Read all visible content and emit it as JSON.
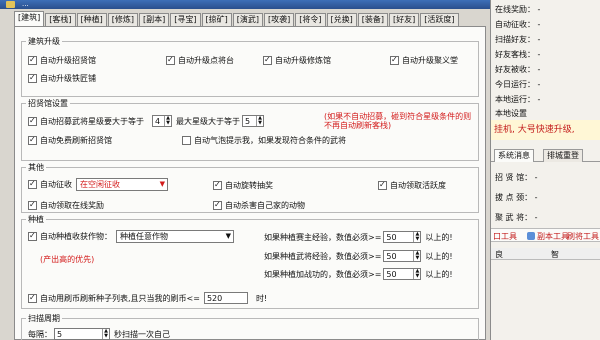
{
  "window": {
    "title": "..."
  },
  "tabs": [
    "[建筑]",
    "[客栈]",
    "[种植]",
    "[修炼]",
    "[副本]",
    "[寻宝]",
    "[掠矿]",
    "[演武]",
    "[攻袭]",
    "[将令]",
    "[兑换]",
    "[装备]",
    "[好友]",
    "[活跃度]"
  ],
  "jianzhu": {
    "title": "建筑升级",
    "items": [
      "自动升级招贤馆",
      "自动升级点将台",
      "自动升级修炼馆",
      "自动升级聚义堂",
      "自动升级铁匠铺"
    ]
  },
  "zhaoxian": {
    "title": "招贤馆设置",
    "star_label": "自动招募武将星级要大于等于",
    "star_value": "4",
    "max_label": "最大星级大于等于",
    "max_value": "5",
    "note": "(如果不自动招募，碰到符合星级条件的则不再自动刷新客栈)",
    "refresh_label": "自动免费刷新招贤馆",
    "qi_label": "自动气泡提示我，如果发现符合条件的武将"
  },
  "qita": {
    "title": "其他",
    "zhengshou_label": "自动征收",
    "zhengshou_value": "在空闲征收",
    "wuhua_label": "自动旋转抽奖",
    "huoyue_label": "自动领取活跃度",
    "online_label": "自动领取在线奖励",
    "animal_label": "自动杀害自己家的动物"
  },
  "zhongzhi": {
    "title": "种植",
    "auto_label": "自动种植收获作物：",
    "crop_value": "种植任意作物",
    "cond1_label": "如果种植赛主经验，数值必须>=",
    "cond1_value": "50",
    "cond2_label": "如果种植武将经验，数值必须>=",
    "cond2_value": "50",
    "cond3_label": "如果种植加战功的，数值必须>=",
    "cond3_value": "50",
    "unit": "以上的!",
    "note": "(产出高的优先)",
    "refresh_label": "自动用刷币刷新种子列表,且只当我的刷币<=",
    "refresh_value": "520",
    "refresh_unit": "时!"
  },
  "scan": {
    "title": "扫描周期",
    "every_label": "每隔：",
    "every_value": "5",
    "suffix": "秒扫描一次自己"
  },
  "right": {
    "lines": [
      "在线奖励：",
      "自动征收：",
      "扫描好友：",
      "好友客栈：",
      "好友被收：",
      "今日运行：",
      "本地运行：",
      "本地设置"
    ],
    "values": [
      "-",
      "-",
      "-",
      "-",
      "-",
      "-",
      "-",
      ""
    ],
    "banner": "挂机, 大号快速升级, ",
    "tabs": [
      "系统消息",
      "系统消息",
      "排城重登"
    ],
    "info_lines": [
      "招 贤 馆：",
      "拔 点 颈：",
      "聚 武 将："
    ],
    "info_values": [
      "-",
      "-",
      "-"
    ],
    "links": [
      "口工具",
      "副本工具",
      "刷将工具"
    ],
    "head_left": "良",
    "head_right": "智"
  }
}
